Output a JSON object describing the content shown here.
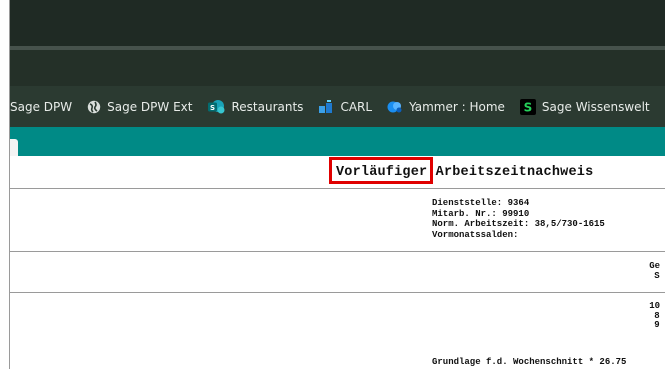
{
  "bookmarks": [
    {
      "label": "Sage DPW",
      "icon": "none"
    },
    {
      "label": "Sage DPW Ext",
      "icon": "globe-icon"
    },
    {
      "label": "Restaurants",
      "icon": "sharepoint-icon"
    },
    {
      "label": "CARL",
      "icon": "chart-icon"
    },
    {
      "label": "Yammer : Home",
      "icon": "yammer-icon"
    },
    {
      "label": "Sage Wissenswelt",
      "icon": "sage-icon"
    }
  ],
  "report": {
    "title_highlight": "Vorläufiger",
    "title_rest": "Arbeitszeitnachweis",
    "dienststelle": "Dienststelle: 9364",
    "mitarb": "Mitarb. Nr.: 99910",
    "norm": "Norm. Arbeitszeit: 38,5/730-1615",
    "vormonat": "Vormonatssalden:",
    "col_header_1": "Ge",
    "col_header_2": "S",
    "val_1": "10",
    "val_2": "8",
    "val_3": "9",
    "footer": "Grundlage f.d. Wochenschnitt *  26.75"
  },
  "colors": {
    "highlight": "#e00000",
    "teal_bar": "#008a86",
    "bookmark_bar": "#2b3a31"
  }
}
